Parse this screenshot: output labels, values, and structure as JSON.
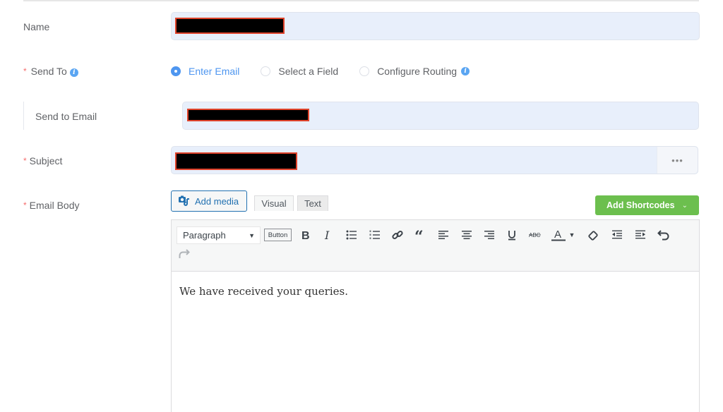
{
  "form": {
    "name": {
      "label": "Name",
      "value_redacted": true
    },
    "send_to": {
      "label": "Send To",
      "required": true,
      "info_icon": "info-icon",
      "options": [
        {
          "label": "Enter Email",
          "checked": true
        },
        {
          "label": "Select a Field",
          "checked": false
        },
        {
          "label": "Configure Routing",
          "checked": false,
          "info_icon": "info-icon"
        }
      ]
    },
    "send_to_email": {
      "label": "Send to Email",
      "value_redacted": true
    },
    "subject": {
      "label": "Subject",
      "required": true,
      "value_redacted": true,
      "more_label": "•••"
    },
    "email_body": {
      "label": "Email Body",
      "required": true,
      "add_media_label": "Add media",
      "tabs": [
        {
          "label": "Visual",
          "active": true
        },
        {
          "label": "Text",
          "active": false
        }
      ],
      "shortcodes_label": "Add Shortcodes",
      "toolbar": {
        "format_select": "Paragraph",
        "button_label": "Button",
        "icons": [
          "bold-icon",
          "italic-icon",
          "bullet-list-icon",
          "numbered-list-icon",
          "link-icon",
          "blockquote-icon",
          "align-left-icon",
          "align-center-icon",
          "align-right-icon",
          "underline-icon",
          "strikethrough-icon",
          "text-color-icon",
          "color-dropdown-icon",
          "clear-formatting-icon",
          "outdent-icon",
          "indent-icon",
          "undo-icon",
          "redo-icon"
        ]
      },
      "content": "We have received your queries."
    }
  },
  "colors": {
    "accent": "#4e96f0",
    "required": "#f56c6c",
    "input_bg": "#e8effb",
    "shortcodes_bg": "#6cbf4e",
    "redaction_border": "#e0432b"
  }
}
